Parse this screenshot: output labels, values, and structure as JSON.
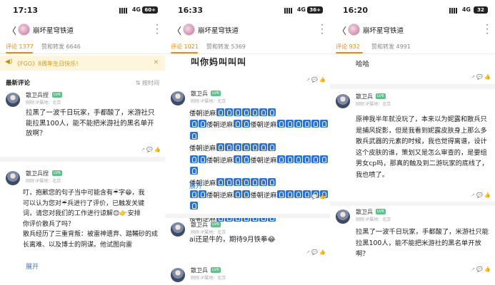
{
  "channel_name": "崩坏星穹铁道",
  "labels": {
    "reply_hint": "赞和转发",
    "level": "LV6",
    "meta": "刚刚 IP属地：北京",
    "expand": "展开"
  },
  "panels": [
    {
      "status": {
        "time": "17:13",
        "network": "4G",
        "battery": "60+"
      },
      "tabs": {
        "comments": "评论 1377",
        "likes": "赞和转发 6646"
      },
      "banner": "《FGO》8周年生日快乐！",
      "latest_label": "最新评论",
      "sort_label": "按时间",
      "comments": [
        {
          "user": "散卫兵捏",
          "text": "拉黑了一波千日玩家，手都酸了，米游社只能拉黑100人，能不能把米游社的黑名单开放啊？"
        },
        {
          "user": "散卫兵捏",
          "text_lines": [
            "叮，抱歉您的句子当中可能含有☔字😁，我",
            "可以认为您对☔兵进行了评价，已触发关键",
            "词，请您对我们的工作进行谅解😊👉安排",
            "你评价散兵了吗？"
          ],
          "text_more": "散兵经历了三重背叛：被雷神遗弃、踏鞴砂的成长离难、以及博士的阴谋。他试图向雷"
        }
      ]
    },
    {
      "status": {
        "time": "16:33",
        "network": "4G",
        "battery": "36+"
      },
      "tabs": {
        "comments": "评论 1021",
        "likes": "赞和转发 5369"
      },
      "cut_text": "叫你妈叫叫叫",
      "comments": [
        {
          "user": "散卫兵",
          "repeat_word": "倭朝逆麻"
        },
        {
          "user": "散卫兵",
          "text": "ai还是牛的，期待9月铁拳😂"
        },
        {
          "user": "散卫兵"
        }
      ]
    },
    {
      "status": {
        "time": "16:20",
        "network": "4G",
        "battery": "32"
      },
      "tabs": {
        "comments": "评论 932",
        "likes": "赞和转发 4991"
      },
      "top_text": "哈哈",
      "comments": [
        {
          "user": "散卫兵",
          "text": "原神我半年就没玩了，本来以为妮露和散兵只是捕风捉影，但是我看到妮露皮肤身上那么多散兵武器的元素的时候，我也觉得离谱，设计这个皮肤的谁，策划又是怎么审查的，是要组男女cp吗，那真的触及到二游玩家的底线了，我也喷了。"
        },
        {
          "user": "散卫兵",
          "text": "拉黑了一波千日玩家，手都酸了，米游社只能拉黑100人，能不能把米游社的黑名单开放啊？"
        }
      ]
    }
  ]
}
